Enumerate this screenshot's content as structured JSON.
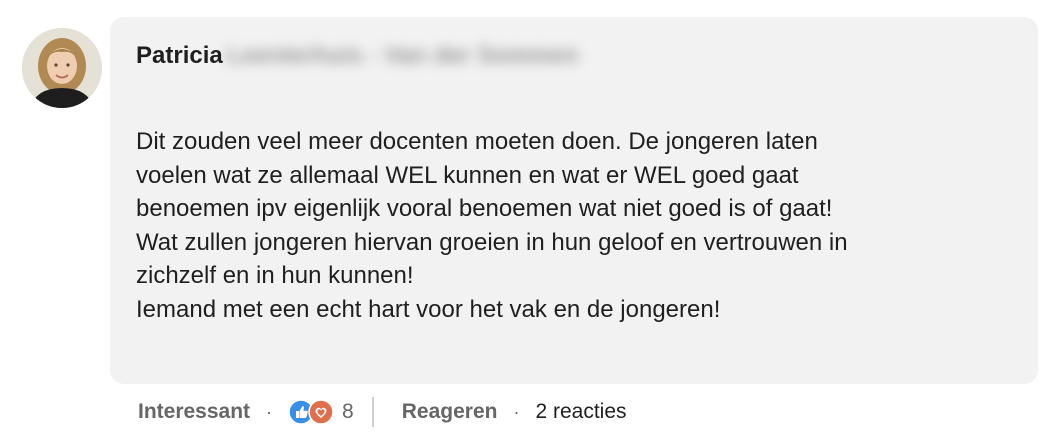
{
  "comment": {
    "author_first_name": "Patricia",
    "author_last_name": "Leenterhuis - Van der Sommen",
    "body_lines": [
      "Dit zouden veel meer docenten moeten doen. De jongeren laten",
      "voelen wat ze allemaal WEL kunnen en wat er WEL goed gaat",
      "benoemen ipv eigenlijk vooral benoemen wat niet goed is of gaat!",
      "Wat zullen jongeren hiervan groeien in hun geloof en vertrouwen in",
      "zichzelf en in hun kunnen!",
      "Iemand met een echt hart voor het vak en de jongeren!"
    ]
  },
  "actions": {
    "react_label": "Interessant",
    "separator": "·",
    "reaction_icons": [
      "like-icon",
      "love-icon"
    ],
    "reaction_count": "8",
    "reply_label": "Reageren",
    "reply_count_label": "2 reacties"
  },
  "colors": {
    "bubble_bg": "#f2f2f2",
    "text": "#1f1f1f",
    "muted": "#666666",
    "like_blue": "#378fe9",
    "love_red": "#df704d"
  }
}
